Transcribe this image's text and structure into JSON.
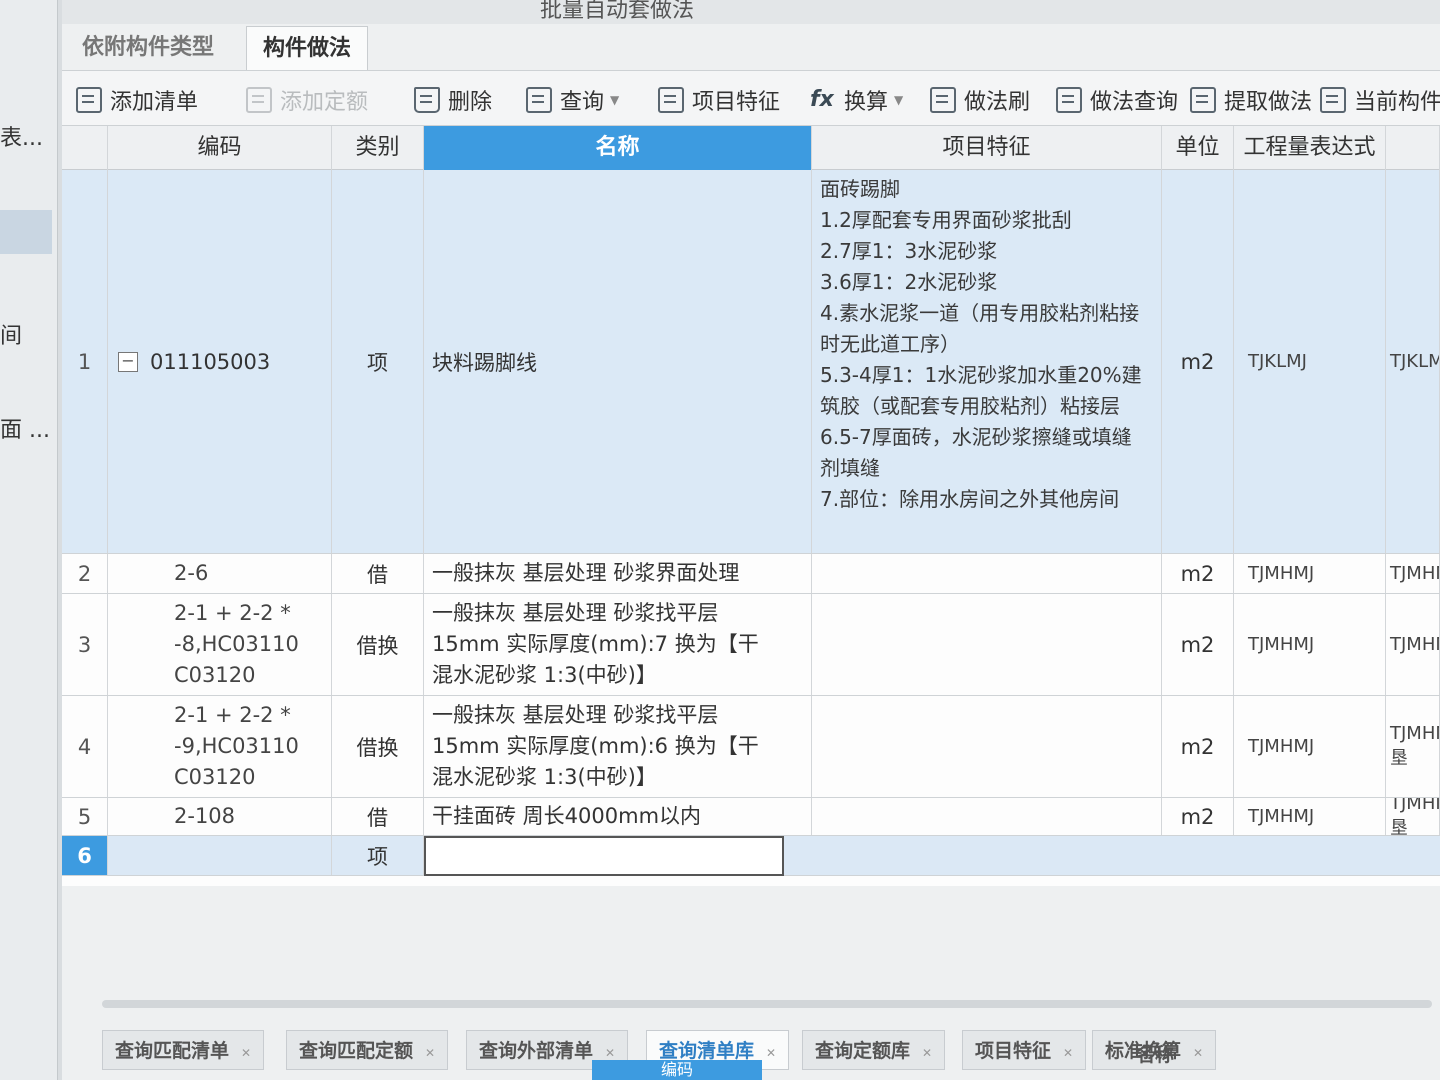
{
  "left_panel": {
    "items": [
      "表...",
      "间",
      "面 ..."
    ]
  },
  "top_strip_text": "批量自动套做法",
  "top_tabs": [
    "依附构件类型",
    "构件做法"
  ],
  "toolbar": {
    "add_list": "添加清单",
    "add_quota": "添加定额",
    "delete": "删除",
    "query": "查询",
    "item_feature": "项目特征",
    "convert": "换算",
    "method_brush": "做法刷",
    "method_query": "做法查询",
    "extract_method": "提取做法",
    "current_component": "当前构件自"
  },
  "columns": {
    "code": "编码",
    "type": "类别",
    "name": "名称",
    "feature": "项目特征",
    "unit": "单位",
    "expr": "工程量表达式"
  },
  "rows": [
    {
      "num": "1",
      "code": "011105003",
      "type": "项",
      "name": "块料踢脚线",
      "features": [
        "面砖踢脚",
        "1.2厚配套专用界面砂浆批刮",
        "2.7厚1：3水泥砂浆",
        "3.6厚1：2水泥砂浆",
        "4.素水泥浆一道（用专用胶粘剂粘接",
        "时无此道工序）",
        "5.3-4厚1：1水泥砂浆加水重20%建",
        "筑胶（或配套专用胶粘剂）粘接层",
        "6.5-7厚面砖，水泥砂浆擦缝或填缝",
        "剂填缝",
        "7.部位：除用水房间之外其他房间"
      ],
      "unit": "m2",
      "expr": "TJKLMJ",
      "extra": "TJKLMJ"
    },
    {
      "num": "2",
      "code": [
        "2-6"
      ],
      "type": "借",
      "name": [
        "一般抹灰 基层处理 砂浆界面处理"
      ],
      "unit": "m2",
      "expr": "TJMHMJ",
      "extra": "TJMHMJ<"
    },
    {
      "num": "3",
      "code": [
        "2-1 + 2-2 *",
        "-8,HC03110",
        "C03120"
      ],
      "type": "借换",
      "name": [
        "一般抹灰 基层处理 砂浆找平层",
        "15mm  实际厚度(mm):7  换为【干",
        "混水泥砂浆 1:3(中砂)】"
      ],
      "unit": "m2",
      "expr": "TJMHMJ",
      "extra": "TJMHMJ<"
    },
    {
      "num": "4",
      "code": [
        "2-1 + 2-2 *",
        "-9,HC03110",
        "C03120"
      ],
      "type": "借换",
      "name": [
        "一般抹灰 基层处理 砂浆找平层",
        "15mm  实际厚度(mm):6  换为【干",
        "混水泥砂浆 1:3(中砂)】"
      ],
      "unit": "m2",
      "expr": "TJMHMJ",
      "extra": "TJMHMJ<垦"
    },
    {
      "num": "5",
      "code": [
        "2-108"
      ],
      "type": "借",
      "name": [
        "干挂面砖 周长4000mm以内"
      ],
      "unit": "m2",
      "expr": "TJMHMJ",
      "extra": "TJMHMJ<垦"
    },
    {
      "num": "6",
      "type": "项"
    }
  ],
  "bottom_tabs": [
    "查询匹配清单",
    "查询匹配定额",
    "查询外部清单",
    "查询清单库",
    "查询定额库",
    "项目特征",
    "标准换算"
  ],
  "bottom_columns": {
    "name": "名称",
    "code": "编码"
  }
}
